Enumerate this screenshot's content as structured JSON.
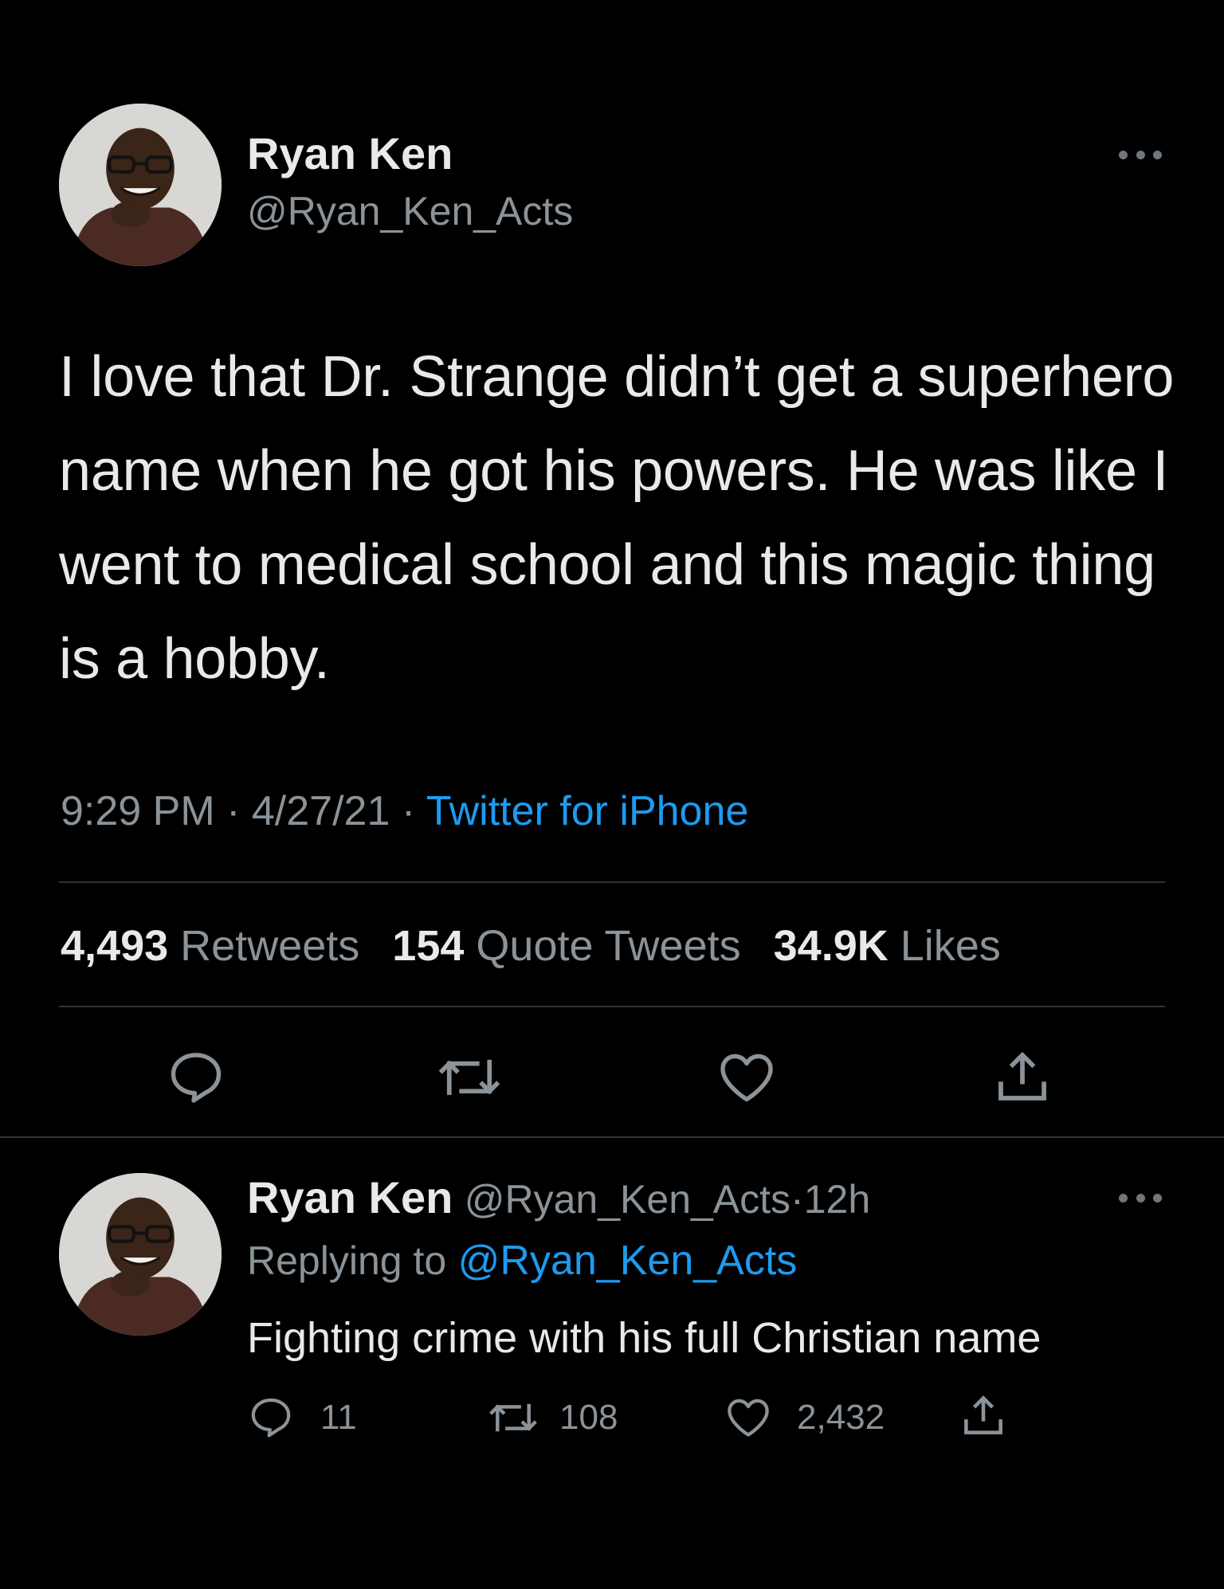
{
  "main_tweet": {
    "author_name": "Ryan Ken",
    "author_handle": "@Ryan_Ken_Acts",
    "text": "I love that Dr. Strange didn’t get a superhero name when he got his powers. He was like I went to medical school and this magic thing is a hobby.",
    "time": "9:29 PM",
    "date": "4/27/21",
    "separator": "·",
    "source": "Twitter for iPhone",
    "stats": {
      "retweets_count": "4,493",
      "retweets_label": "Retweets",
      "quotes_count": "154",
      "quotes_label": "Quote Tweets",
      "likes_count": "34.9K",
      "likes_label": "Likes"
    }
  },
  "reply_tweet": {
    "author_name": "Ryan Ken",
    "author_handle": "@Ryan_Ken_Acts",
    "separator": "·",
    "time_ago": "12h",
    "replying_prefix": "Replying to",
    "replying_to": "@Ryan_Ken_Acts",
    "text": "Fighting crime with his full Christian name",
    "reply_count": "11",
    "retweet_count": "108",
    "like_count": "2,432"
  },
  "colors": {
    "background": "#000000",
    "primary_text": "#e7e9ea",
    "secondary_text": "#8b9399",
    "link": "#1d9bf0",
    "divider": "#2f3336"
  },
  "icons": {
    "more": "more-horizontal-icon",
    "reply": "reply-bubble-icon",
    "retweet": "retweet-icon",
    "like": "heart-icon",
    "share": "share-upload-icon"
  }
}
